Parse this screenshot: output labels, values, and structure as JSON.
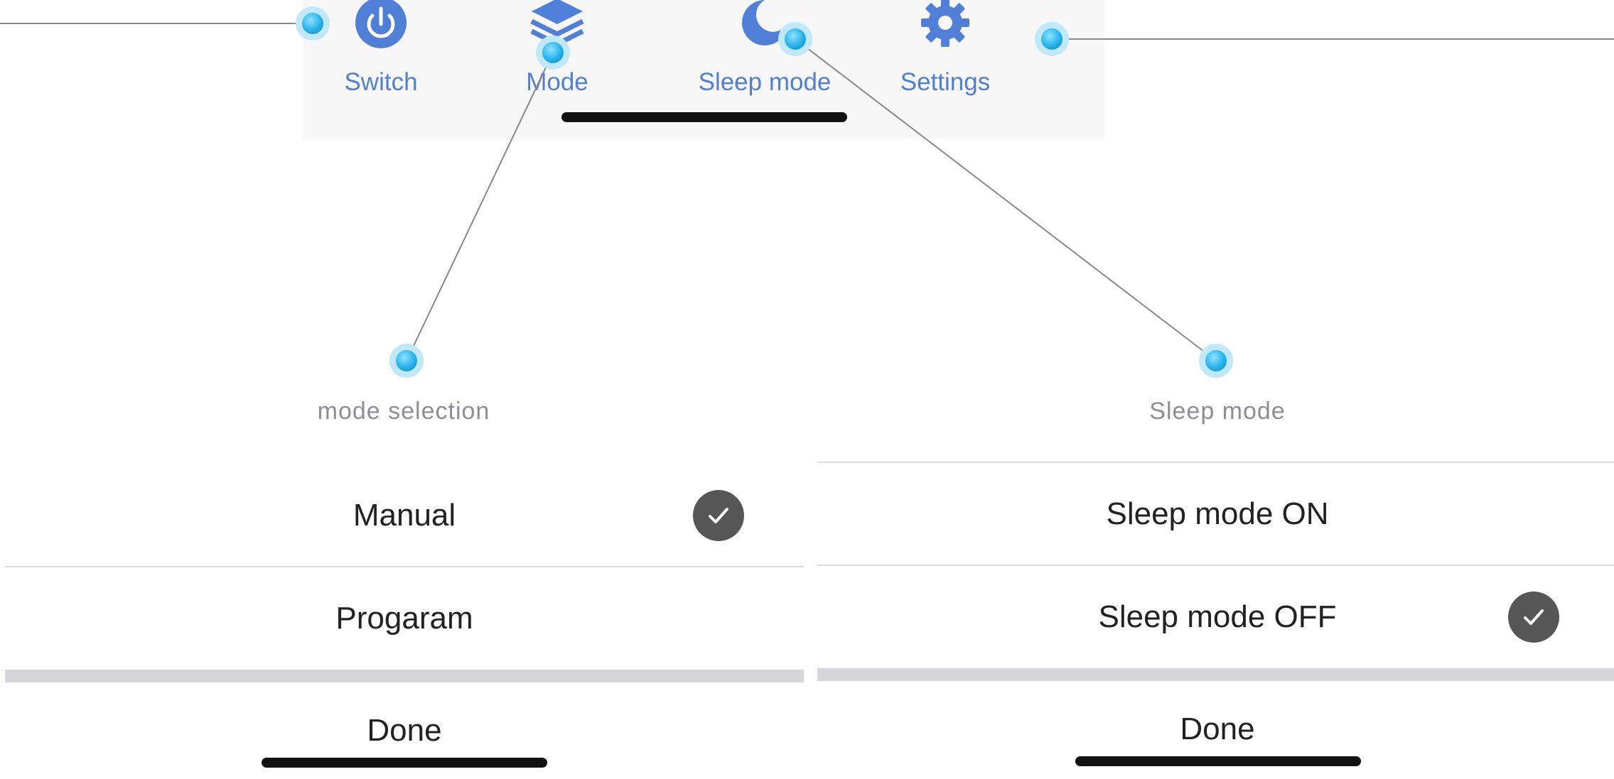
{
  "tabbar": {
    "tabs": [
      {
        "label": "Switch",
        "icon": "power-icon"
      },
      {
        "label": "Mode",
        "icon": "layers-icon"
      },
      {
        "label": "Sleep mode",
        "icon": "moon-icon"
      },
      {
        "label": "Settings",
        "icon": "gear-icon"
      }
    ]
  },
  "mode_sheet": {
    "title": "mode selection",
    "options": [
      {
        "label": "Manual",
        "selected": true
      },
      {
        "label": "Progaram",
        "selected": false
      }
    ],
    "done_label": "Done"
  },
  "sleep_sheet": {
    "title": "Sleep mode",
    "options": [
      {
        "label": "Sleep mode ON",
        "selected": false
      },
      {
        "label": "Sleep mode OFF",
        "selected": true
      }
    ],
    "done_label": "Done"
  },
  "colors": {
    "accent": "#4f7fd6",
    "check_bg": "#565656",
    "annotation_dot": "#2bb3ec"
  }
}
